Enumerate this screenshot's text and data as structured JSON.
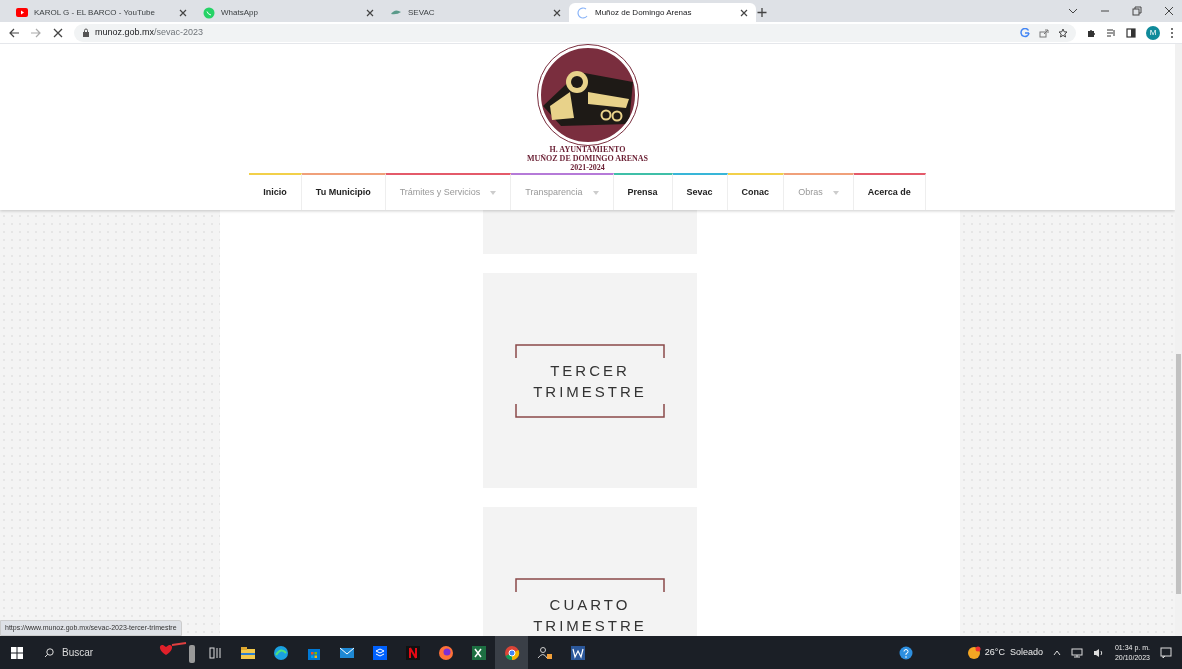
{
  "browser": {
    "tabs": [
      {
        "title": "KAROL G - EL BARCO - YouTube",
        "selected": false
      },
      {
        "title": "WhatsApp",
        "selected": false
      },
      {
        "title": "SEVAC",
        "selected": false
      },
      {
        "title": "Muñoz de Domingo Arenas",
        "selected": true
      }
    ],
    "address": {
      "domain": "munoz.gob.mx",
      "path": "/sevac-2023"
    },
    "profile": "M"
  },
  "header": {
    "logo_lines": [
      "H. AYUNTAMIENTO",
      "MUÑOZ DE DOMINGO ARENAS",
      "2021-2024"
    ],
    "nav": [
      {
        "label": "Inicio",
        "dropdown": false,
        "color": "#f2d04a"
      },
      {
        "label": "Tu Municipio",
        "dropdown": false,
        "color": "#f0a07a"
      },
      {
        "label": "Trámites y Servicios",
        "dropdown": true,
        "color": "#e45a6a"
      },
      {
        "label": "Transparencia",
        "dropdown": true,
        "color": "#b57ad8"
      },
      {
        "label": "Prensa",
        "dropdown": false,
        "color": "#3fbfa8"
      },
      {
        "label": "Sevac",
        "dropdown": false,
        "color": "#38b6d8"
      },
      {
        "label": "Conac",
        "dropdown": false,
        "color": "#f2d04a"
      },
      {
        "label": "Obras",
        "dropdown": true,
        "color": "#f0a07a"
      },
      {
        "label": "Acerca de",
        "dropdown": false,
        "color": "#e45a6a"
      }
    ]
  },
  "cards": [
    {
      "lines": [
        "TERCER",
        "TRIMESTRE"
      ]
    },
    {
      "lines": [
        "CUARTO",
        "TRIMESTRE"
      ]
    }
  ],
  "status_url": "https://www.munoz.gob.mx/sevac-2023-tercer-trimestre",
  "taskbar": {
    "search_placeholder": "Buscar",
    "apps": [
      {
        "kind": "taskview",
        "selected": false
      },
      {
        "kind": "files",
        "selected": false
      },
      {
        "kind": "edge",
        "selected": false
      },
      {
        "kind": "store",
        "selected": false
      },
      {
        "kind": "mail",
        "selected": false
      },
      {
        "kind": "dropbox",
        "selected": false
      },
      {
        "kind": "netflix",
        "selected": false
      },
      {
        "kind": "firefox",
        "selected": false
      },
      {
        "kind": "excel",
        "selected": false
      },
      {
        "kind": "chrome",
        "selected": true
      },
      {
        "kind": "people",
        "selected": false
      },
      {
        "kind": "word",
        "selected": false
      }
    ],
    "weather": "26°C  Soleado",
    "time": "01:34 p. m.",
    "date": "20/10/2023"
  }
}
